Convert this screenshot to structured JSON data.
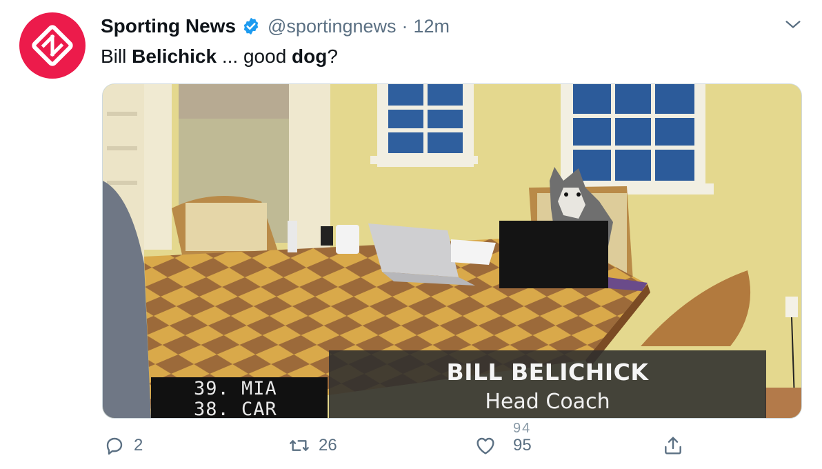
{
  "tweet": {
    "author": {
      "display_name": "Sporting News",
      "handle": "@sportingnews",
      "verified": true,
      "avatar_icon": "sporting-news-logo",
      "avatar_color": "#ec1b4b"
    },
    "separator": "·",
    "time": "12m",
    "text": {
      "part1": "Bill ",
      "bold1": "Belichick",
      "part2": " ... good ",
      "bold2": "dog",
      "part3": "?"
    },
    "media": {
      "score_lines": [
        "39. MIA",
        "38. CAR"
      ],
      "lower_third_name": "BILL BELICHICK",
      "lower_third_title": "Head Coach"
    },
    "actions": {
      "reply_count": "2",
      "retweet_count": "26",
      "like_count": "95",
      "like_count_prev": "94"
    },
    "icons": {
      "reply": "reply-icon",
      "retweet": "retweet-icon",
      "like": "heart-icon",
      "share": "share-icon",
      "menu": "chevron-down-icon"
    },
    "colors": {
      "brand": "#ec1b4b",
      "verified": "#1d9bf0",
      "secondary_text": "#5b7083"
    }
  }
}
